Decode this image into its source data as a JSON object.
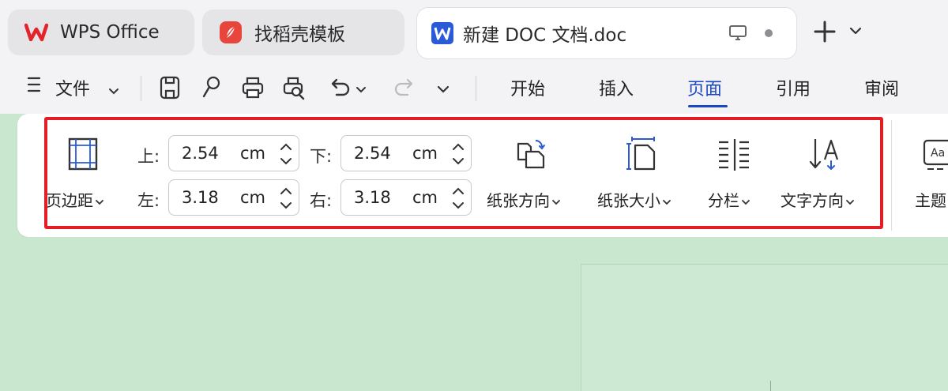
{
  "tabs": [
    {
      "label": "WPS Office",
      "icon": "wps-logo-icon"
    },
    {
      "label": "找稻壳模板",
      "icon": "docer-logo-icon"
    },
    {
      "label": "新建 DOC 文档.doc",
      "icon": "word-doc-icon"
    }
  ],
  "menu": {
    "file_label": "文件",
    "tabs": [
      "开始",
      "插入",
      "页面",
      "引用",
      "审阅"
    ],
    "active_tab": "页面"
  },
  "ribbon": {
    "margins_label": "页边距",
    "margin_top_label": "上:",
    "margin_top_value": "2.54",
    "margin_bottom_label": "下:",
    "margin_bottom_value": "2.54",
    "margin_left_label": "左:",
    "margin_left_value": "3.18",
    "margin_right_label": "右:",
    "margin_right_value": "3.18",
    "unit": "cm",
    "orientation_label": "纸张方向",
    "size_label": "纸张大小",
    "columns_label": "分栏",
    "text_direction_label": "文字方向",
    "theme_label": "主题"
  },
  "colors": {
    "accent": "#1c47c4",
    "highlight_border": "#e41d25",
    "wps_red": "#e3242b",
    "word_blue": "#2a5bd7",
    "canvas_green": "#c9e6cf"
  }
}
